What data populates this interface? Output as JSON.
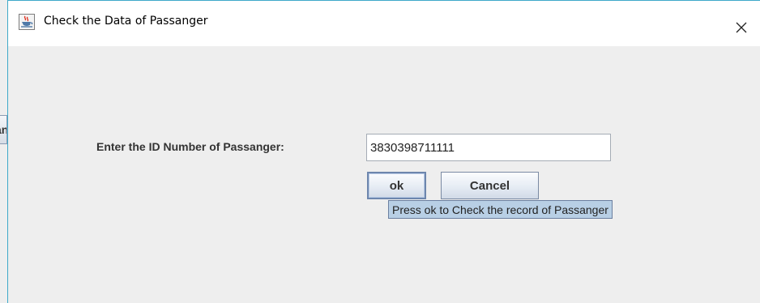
{
  "window": {
    "title": "Check the Data of Passanger",
    "title_icon": "java-coffee-icon",
    "close_icon": "close-icon"
  },
  "background_button": {
    "label": "an"
  },
  "form": {
    "id_label": "Enter the ID Number of Passanger:",
    "id_value": "3830398711111"
  },
  "buttons": {
    "ok_label": "ok",
    "cancel_label": "Cancel"
  },
  "tooltip": {
    "text": "Press ok to Check the record of Passanger"
  },
  "colors": {
    "window_border": "#3fa9c9",
    "tooltip_bg": "#b8cfe5",
    "background": "#eeeeee"
  }
}
